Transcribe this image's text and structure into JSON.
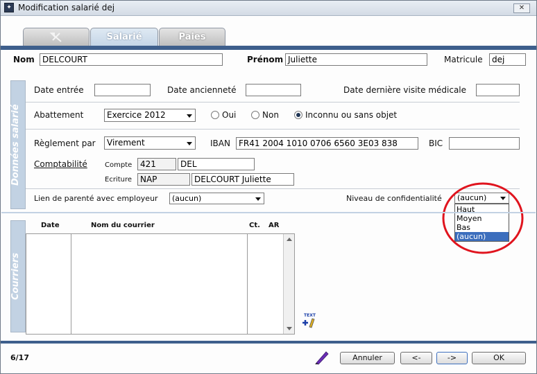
{
  "window": {
    "title": "Modification salarié dej",
    "close_glyph": "✕"
  },
  "tabs": [
    {
      "label": "",
      "icon": "tool-icon"
    },
    {
      "label": "Salarié",
      "active": true
    },
    {
      "label": "Paies"
    }
  ],
  "header": {
    "nom_label": "Nom",
    "nom_value": "DELCOURT",
    "prenom_label": "Prénom",
    "prenom_value": "Juliette",
    "matricule_label": "Matricule",
    "matricule_value": "dej"
  },
  "donnees": {
    "section_title": "Données salarié",
    "date_entree_label": "Date entrée",
    "date_entree_value": "",
    "date_anciennete_label": "Date ancienneté",
    "date_anciennete_value": "",
    "date_visite_label": "Date dernière visite médicale",
    "date_visite_value": "",
    "abattement_label": "Abattement",
    "abattement_value": "Exercice 2012",
    "radio_oui": "Oui",
    "radio_non": "Non",
    "radio_inconnu": "Inconnu ou sans objet",
    "reglement_label": "Règlement par",
    "reglement_value": "Virement",
    "iban_label": "IBAN",
    "iban_value": "FR41 2004 1010 0706 6560 3E03 838",
    "bic_label": "BIC",
    "bic_value": "",
    "comptabilite_label": "Comptabilité",
    "compte_label": "Compte",
    "compte_code": "421",
    "compte_value": "DEL",
    "ecriture_label": "Ecriture",
    "ecriture_code": "NAP",
    "ecriture_value": "DELCOURT Juliette",
    "lien_label": "Lien de parenté avec employeur",
    "lien_value": "(aucun)",
    "niveau_label": "Niveau de confidentialité",
    "niveau_value": "(aucun)",
    "niveau_options": [
      "Haut",
      "Moyen",
      "Bas",
      "(aucun)"
    ]
  },
  "courriers": {
    "section_title": "Courriers",
    "col_date": "Date",
    "col_nom": "Nom du courrier",
    "col_ct": "Ct.",
    "col_ar": "AR",
    "text_icon_label": "TEXT"
  },
  "footer": {
    "page_counter": "6/17",
    "annuler": "Annuler",
    "prev": "<-",
    "next": "->",
    "ok": "OK"
  },
  "colors": {
    "accent": "#3e5f8c",
    "panel": "#c2d2e3",
    "highlight_circle": "#e0141e",
    "selection": "#3c6ebd"
  }
}
